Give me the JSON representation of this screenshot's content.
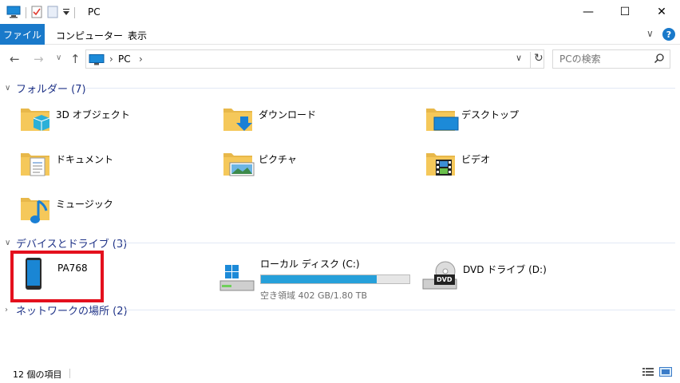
{
  "window": {
    "title": "PC",
    "minimize_glyph": "—",
    "maximize_glyph": "☐",
    "close_glyph": "✕"
  },
  "ribbon": {
    "tabs": [
      {
        "label": "ファイル",
        "active": true
      },
      {
        "label": "コンピューター",
        "active": false
      },
      {
        "label": "表示",
        "active": false
      }
    ],
    "help_glyph": "?",
    "expand_glyph": "∨"
  },
  "nav": {
    "back_glyph": "←",
    "forward_glyph": "→",
    "recent_glyph": "∨",
    "up_glyph": "↑",
    "breadcrumb": "PC",
    "crumb_sep": "›",
    "dropdown_glyph": "∨",
    "refresh_glyph": "↻"
  },
  "search": {
    "placeholder": "PCの検索"
  },
  "groups": {
    "folders": {
      "label": "フォルダー (7)",
      "chevron": "∨"
    },
    "devices": {
      "label": "デバイスとドライブ (3)",
      "chevron": "∨"
    },
    "network": {
      "label": "ネットワークの場所 (2)",
      "chevron": "›"
    }
  },
  "folders": [
    {
      "label": "3D オブジェクト",
      "icon": "3d-objects-folder-icon"
    },
    {
      "label": "ダウンロード",
      "icon": "downloads-folder-icon"
    },
    {
      "label": "デスクトップ",
      "icon": "desktop-folder-icon"
    },
    {
      "label": "ドキュメント",
      "icon": "documents-folder-icon"
    },
    {
      "label": "ピクチャ",
      "icon": "pictures-folder-icon"
    },
    {
      "label": "ビデオ",
      "icon": "videos-folder-icon"
    },
    {
      "label": "ミュージック",
      "icon": "music-folder-icon"
    }
  ],
  "devices": [
    {
      "label": "PA768",
      "icon": "phone-device-icon"
    },
    {
      "label": "ローカル ディスク (C:)",
      "icon": "local-disk-icon",
      "free_text": "空き領域 402 GB/1.80 TB",
      "used_fraction": 0.78
    },
    {
      "label": "DVD ドライブ (D:)",
      "icon": "dvd-drive-icon",
      "dvd_text": "DVD"
    }
  ],
  "status": {
    "item_count": "12 個の項目"
  },
  "colors": {
    "accent": "#1979ca",
    "group_header": "#1e3287",
    "highlight": "#e4101d",
    "drive_fill": "#26a0da",
    "folder": "#f5c85a"
  }
}
